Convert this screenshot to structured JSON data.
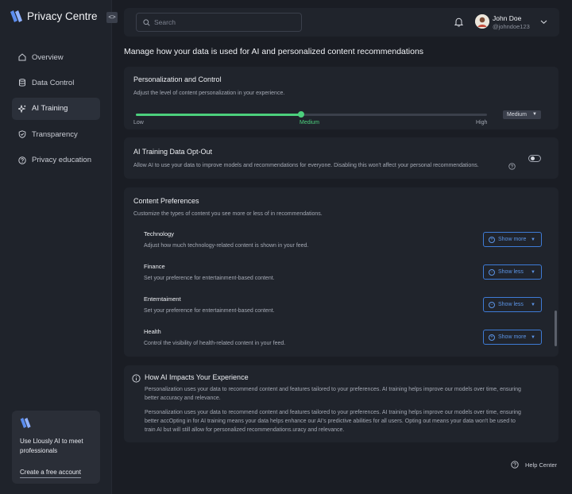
{
  "app": {
    "title": "Privacy Centre",
    "collapse_glyph": "<>"
  },
  "sidebar": {
    "items": [
      {
        "label": "Overview",
        "icon": "home-icon"
      },
      {
        "label": "Data Control",
        "icon": "database-icon"
      },
      {
        "label": "AI Training",
        "icon": "sparkle-icon",
        "active": true
      },
      {
        "label": "Transparency",
        "icon": "shield-icon"
      },
      {
        "label": "Privacy education",
        "icon": "help-circle-icon"
      }
    ],
    "promo": {
      "text": "Use Llously AI to meet professionals",
      "link": "Create a free account"
    }
  },
  "topbar": {
    "search_placeholder": "Search",
    "user": {
      "name": "John Doe",
      "handle": "@johndoe123"
    }
  },
  "page": {
    "heading": "Manage how your data is used for AI and personalized content recommendations"
  },
  "personalization": {
    "title": "Personalization and Control",
    "description": "Adjust the level of content personalization in your experience.",
    "levels": [
      "Low",
      "Medium",
      "High"
    ],
    "current_level": "Medium",
    "slider_fraction": 0.47
  },
  "optout": {
    "title": "AI Training Data Opt-Out",
    "description": "Allow AI to use your data to improve models and recommendations for everyone. Disabling this won't affect your personal recommendations.",
    "enabled": false
  },
  "preferences": {
    "title": "Content Preferences",
    "description": "Customize the types of content you see more or less of in recommendations.",
    "items": [
      {
        "title": "Technology",
        "description": "Adjust how much technology-related content is shown in your feed.",
        "button": "Show more",
        "sign": "+"
      },
      {
        "title": "Finance",
        "description": "Set your preference for entertainment-based content.",
        "button": "Show less",
        "sign": "−"
      },
      {
        "title": "Enterntaiment",
        "description": "Set your preference for entertainment-based content.",
        "button": "Show less",
        "sign": "−"
      },
      {
        "title": "Health",
        "description": "Control the visibility of health-related content in your feed.",
        "button": "Show more",
        "sign": "+"
      }
    ]
  },
  "impact": {
    "title": "How AI Impacts Your Experience",
    "paragraph1": "Personalization uses your data to recommend content and features tailored to your preferences. AI training helps improve our models over time, ensuring better accuracy and relevance.",
    "paragraph2": "Personalization uses your data to recommend content and features tailored to your preferences. AI training helps improve our models over time, ensuring better accOpting in for AI training means your data helps enhance our AI's predictive abilities for all users. Opting out means your data won't be used to train AI but will still allow for personalized recommendations.uracy and relevance."
  },
  "footer": {
    "help_label": "Help Center"
  },
  "colors": {
    "accent_green": "#4cd07d",
    "accent_blue": "#3e7bd6",
    "background": "#1a1d24",
    "card": "#20242c"
  }
}
